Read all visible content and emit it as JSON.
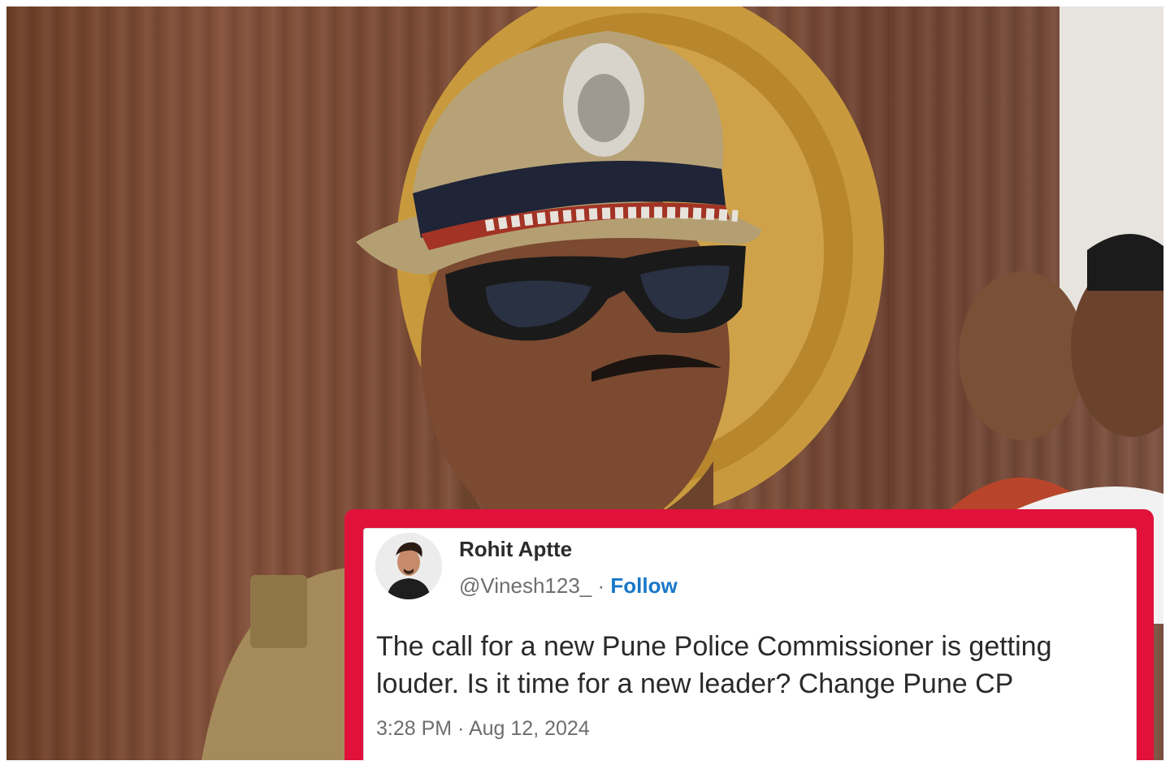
{
  "tweet": {
    "author_name": "Rohit Aptte",
    "handle": "@Vinesh123_",
    "separator": " · ",
    "follow_label": "Follow",
    "text": "The call for a new Pune Police Commissioner is getting louder. Is it time for a new leader? Change Pune CP",
    "time": "3:28 PM",
    "date": "Aug 12, 2024",
    "time_separator": " · "
  },
  "colors": {
    "highlight_border": "#e0123b",
    "follow_link": "#1877c9",
    "background_wood": "#7a4a34"
  },
  "icons": {
    "avatar": "profile-avatar-icon"
  }
}
